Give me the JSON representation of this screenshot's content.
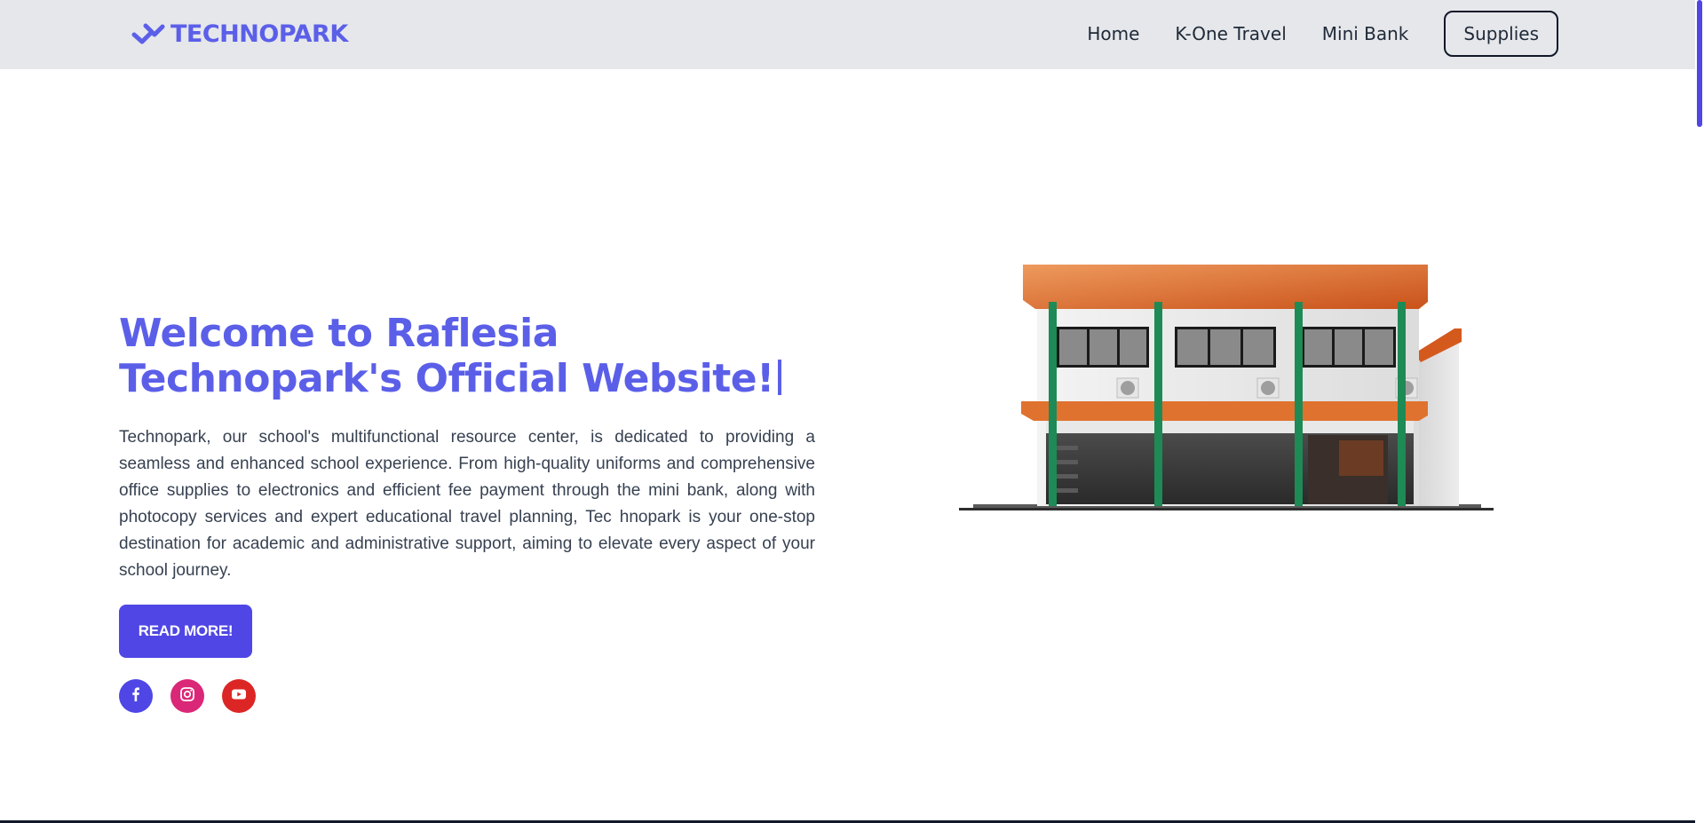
{
  "navbar": {
    "brand": "TECHNOPARK",
    "links": [
      "Home",
      "K-One Travel",
      "Mini Bank"
    ],
    "cta": "Supplies"
  },
  "hero": {
    "title": "Welcome to Raflesia Technopark's Official Website!",
    "description": "Technopark, our school's multifunctional resource center, is dedicated to providing a seamless and enhanced school experience. From high-quality uniforms and comprehensive office supplies to electronics and efficient fee payment through the mini bank, along with photocopy services and expert educational travel planning, Tec hnopark is your one-stop destination for academic and administrative support, aiming to elevate every aspect of your school journey.",
    "button": "READ MORE!"
  },
  "socials": [
    {
      "icon": "facebook-icon",
      "color": "#4f46e5"
    },
    {
      "icon": "instagram-icon",
      "color": "#db2777"
    },
    {
      "icon": "youtube-icon",
      "color": "#dc2626"
    }
  ],
  "colors": {
    "brand": "#5b5fe8",
    "accent": "#4f46e5",
    "navbar_bg": "#e5e7eb"
  }
}
